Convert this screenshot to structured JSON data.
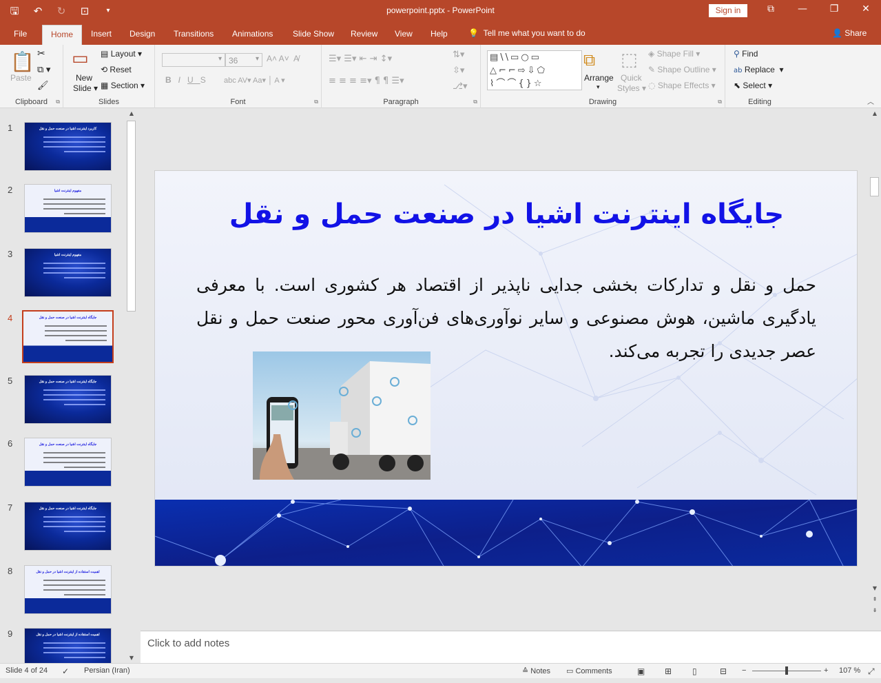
{
  "window": {
    "title": "powerpoint.pptx  -  PowerPoint",
    "sign_in": "Sign in"
  },
  "tabs": [
    "File",
    "Home",
    "Insert",
    "Design",
    "Transitions",
    "Animations",
    "Slide Show",
    "Review",
    "View",
    "Help"
  ],
  "tell_me": "Tell me what you want to do",
  "share": "Share",
  "ribbon": {
    "clipboard": {
      "label": "Clipboard",
      "paste": "Paste"
    },
    "slides": {
      "label": "Slides",
      "new_slide_1": "New",
      "new_slide_2": "Slide",
      "layout": "Layout",
      "reset": "Reset",
      "section": "Section"
    },
    "font": {
      "label": "Font",
      "size": "36"
    },
    "paragraph": {
      "label": "Paragraph"
    },
    "drawing": {
      "label": "Drawing",
      "arrange": "Arrange",
      "quick_styles_1": "Quick",
      "quick_styles_2": "Styles",
      "shape_fill": "Shape Fill",
      "shape_outline": "Shape Outline",
      "shape_effects": "Shape Effects"
    },
    "editing": {
      "label": "Editing",
      "find": "Find",
      "replace": "Replace",
      "select": "Select"
    }
  },
  "thumbnails": [
    {
      "num": "1",
      "style": "dark",
      "title": "کاربرد اینترنت اشیا در صنعت حمل و نقل"
    },
    {
      "num": "2",
      "style": "light",
      "title": "مفهوم اینترنت اشیا"
    },
    {
      "num": "3",
      "style": "dark",
      "title": "مفهوم اینترنت اشیا"
    },
    {
      "num": "4",
      "style": "light",
      "title": "جایگاه اینترنت اشیا در صنعت حمل و نقل"
    },
    {
      "num": "5",
      "style": "dark",
      "title": "جایگاه اینترنت اشیا در صنعت حمل و نقل"
    },
    {
      "num": "6",
      "style": "light",
      "title": "جایگاه اینترنت اشیا در صنعت حمل و نقل"
    },
    {
      "num": "7",
      "style": "dark",
      "title": "جایگاه اینترنت اشیا در صنعت حمل و نقل"
    },
    {
      "num": "8",
      "style": "light",
      "title": "اهمیت استفاده از اینترنت اشیا در حمل و نقل"
    },
    {
      "num": "9",
      "style": "dark",
      "title": "اهمیت استفاده از اینترنت اشیا در حمل و نقل"
    }
  ],
  "active_slide_index": 3,
  "slide": {
    "title": "جایگاه اینترنت اشیا در صنعت حمل و نقل",
    "body": "حمل و نقل و تدارکات بخشی جدایی ناپذیر از اقتصاد هر کشوری است. با معرفی یادگیری ماشین، هوش مصنوعی و سایر نوآوری‌های فن‌آوری محور صنعت حمل و نقل عصر جدیدی را تجربه می‌کند.",
    "title_color": "#1212e6"
  },
  "notes_placeholder": "Click to add notes",
  "status": {
    "slide_count": "Slide 4 of 24",
    "language": "Persian (Iran)",
    "notes": "Notes",
    "comments": "Comments",
    "zoom": "107 %"
  },
  "colors": {
    "accent": "#b7472a",
    "active_thumb": "#c43e1c"
  }
}
